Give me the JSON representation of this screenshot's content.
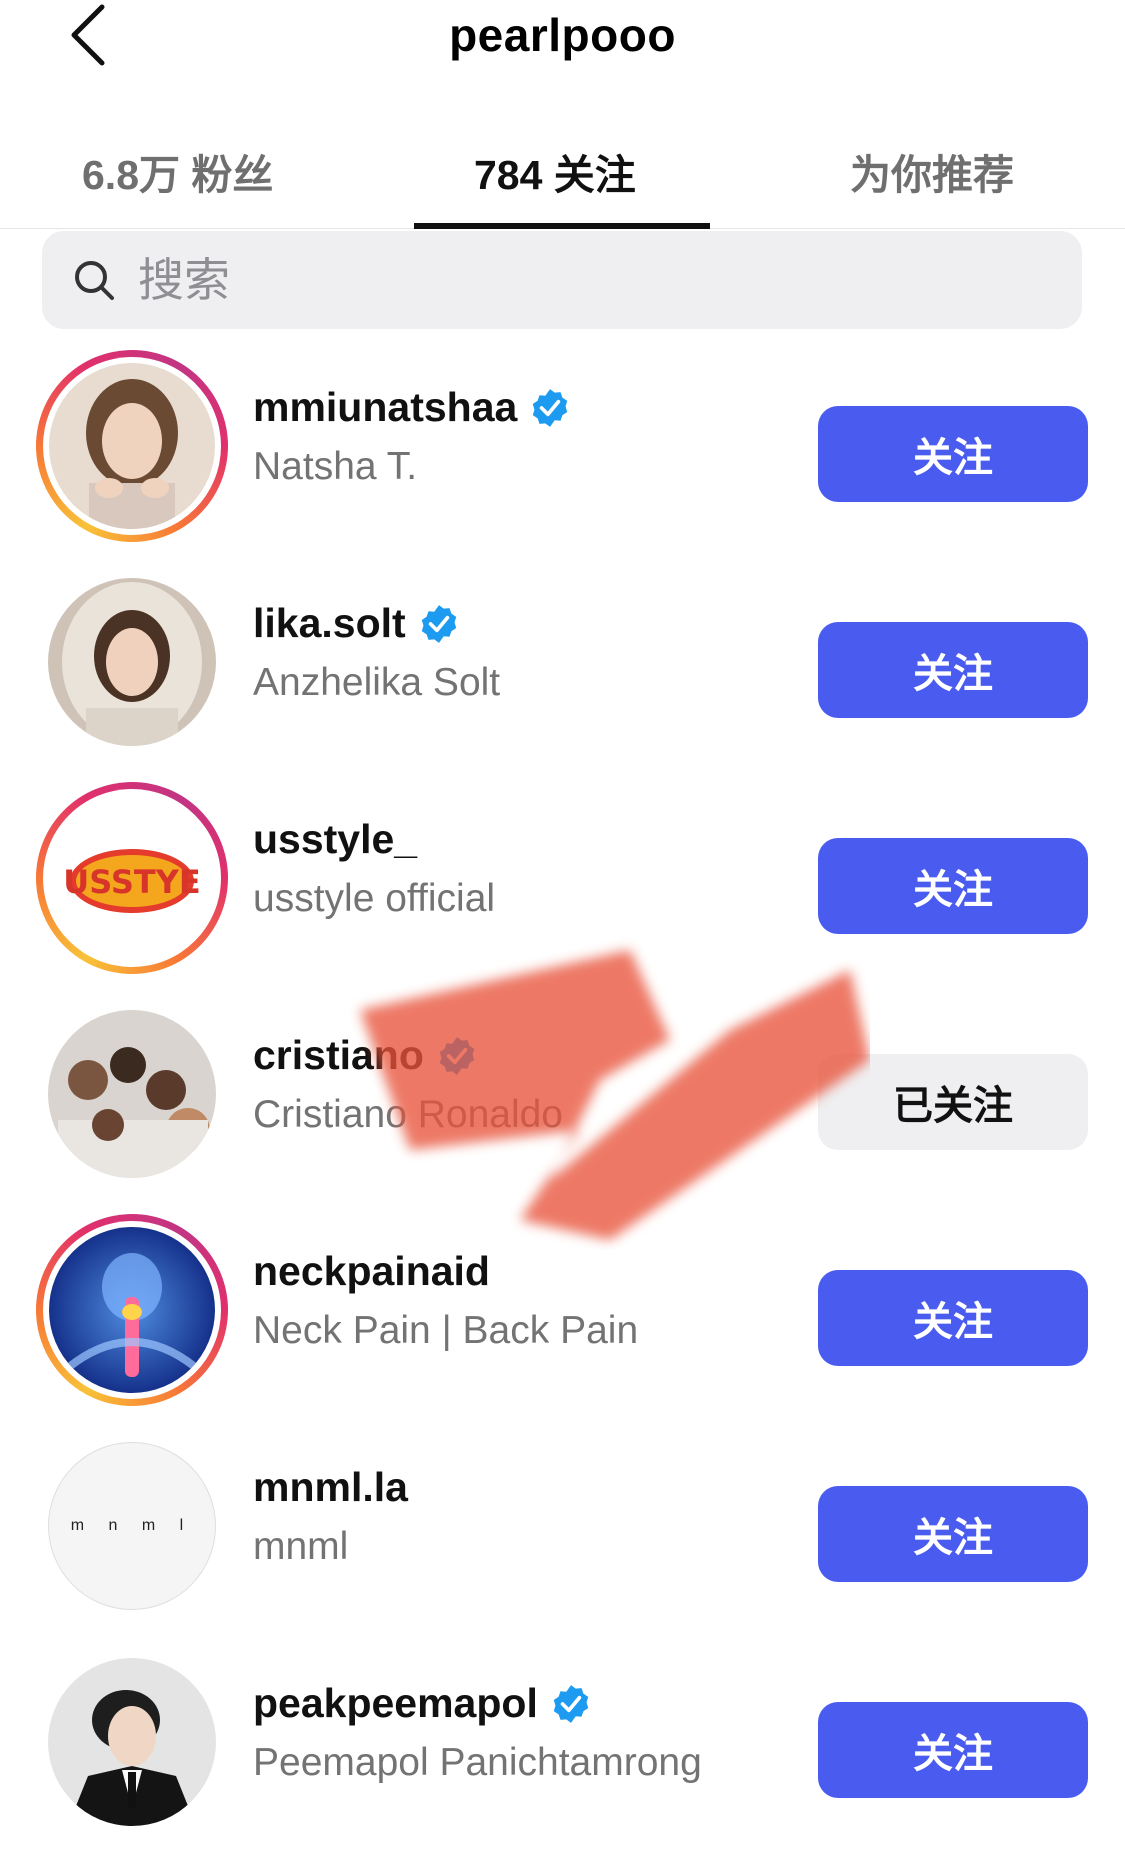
{
  "header": {
    "title": "pearlpooo"
  },
  "tabs": [
    {
      "label": "6.8万 粉丝",
      "active": false
    },
    {
      "label": "784 关注",
      "active": true
    },
    {
      "label": "为你推荐",
      "active": false
    }
  ],
  "search": {
    "placeholder": "搜索"
  },
  "accounts": [
    {
      "username": "mmiunatshaa",
      "full_name": "Natsha T.",
      "verified": true,
      "story_ring": true,
      "button": "关注"
    },
    {
      "username": "lika.solt",
      "full_name": "Anzhelika Solt",
      "verified": true,
      "story_ring": false,
      "button": "关注"
    },
    {
      "username": "usstyle_",
      "full_name": "usstyle official",
      "verified": false,
      "story_ring": true,
      "button": "关注",
      "logo_text": "USSTYE"
    },
    {
      "username": "cristiano",
      "full_name": "Cristiano Ronaldo",
      "verified": true,
      "story_ring": false,
      "button": "已关注"
    },
    {
      "username": "neckpainaid",
      "full_name": "Neck Pain | Back Pain",
      "verified": false,
      "story_ring": true,
      "button": "关注"
    },
    {
      "username": "mnml.la",
      "full_name": "mnml",
      "verified": false,
      "story_ring": false,
      "button": "关注",
      "logo_text": "m n m l"
    },
    {
      "username": "peakpeemapol",
      "full_name": "Peemapol Panichtamrong",
      "verified": true,
      "story_ring": false,
      "button": "关注"
    }
  ],
  "colors": {
    "follow_button": "#4a5cf0",
    "following_button": "#efeff1",
    "verified_badge": "#1d9bf0",
    "scribble": "#e8523a"
  }
}
